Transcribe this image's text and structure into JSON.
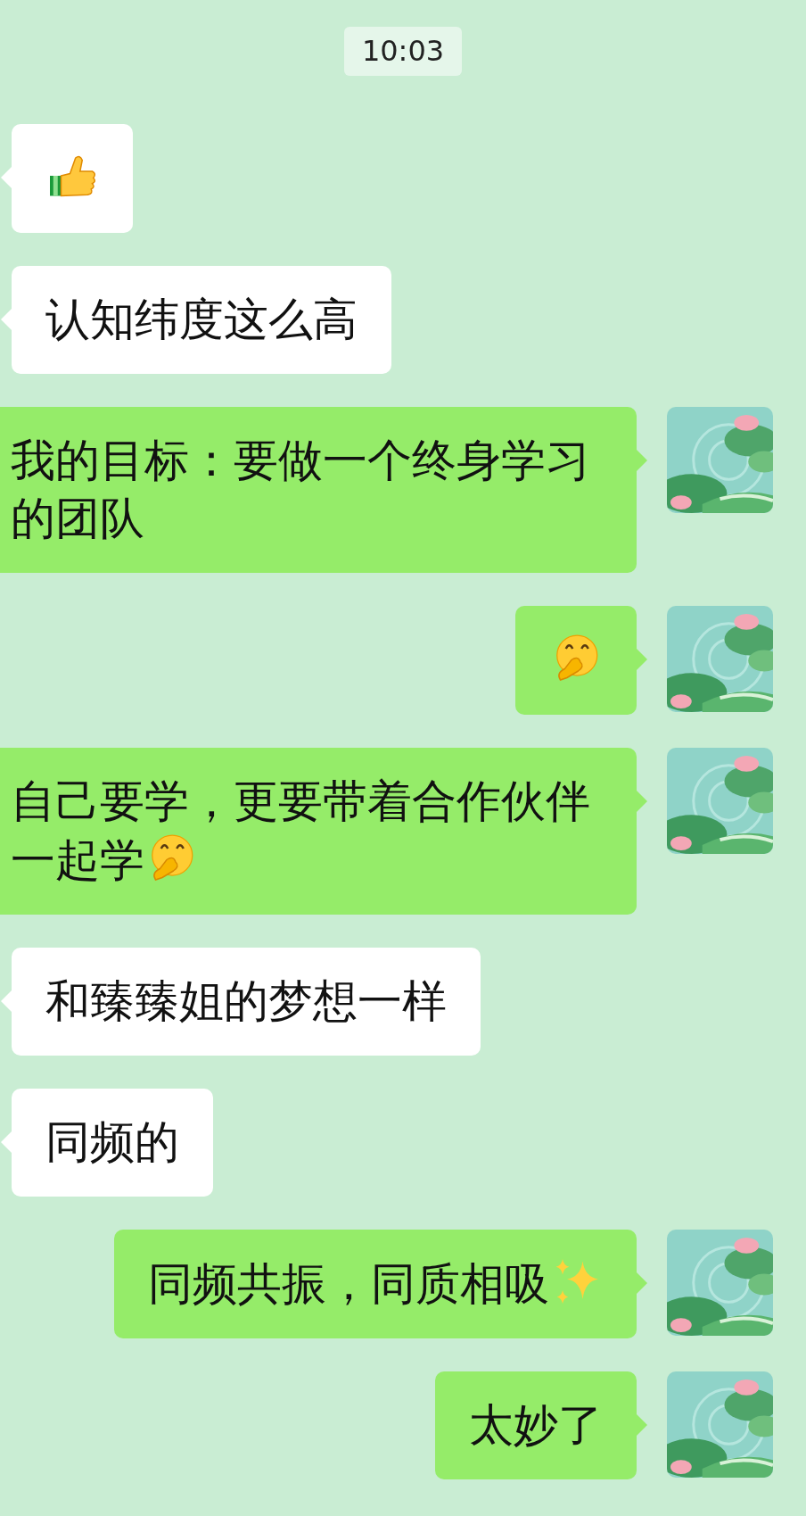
{
  "time": "10:03",
  "messages": [
    {
      "kind": "received",
      "parts": [
        {
          "kind": "thumbs"
        }
      ]
    },
    {
      "kind": "received",
      "parts": [
        {
          "kind": "text",
          "text": "认知纬度这么高"
        }
      ]
    },
    {
      "kind": "sent",
      "parts": [
        {
          "kind": "text",
          "text": "我的目标：要做一个终身学习的团队"
        }
      ]
    },
    {
      "kind": "sent",
      "parts": [
        {
          "kind": "giggle"
        }
      ]
    },
    {
      "kind": "sent",
      "parts": [
        {
          "kind": "text",
          "text": "自己要学，更要带着合作伙伴"
        },
        {
          "kind": "text",
          "text": "一起学"
        },
        {
          "kind": "giggle"
        }
      ]
    },
    {
      "kind": "received",
      "parts": [
        {
          "kind": "text",
          "text": "和臻臻姐的梦想一样"
        }
      ]
    },
    {
      "kind": "received",
      "parts": [
        {
          "kind": "text",
          "text": "同频的"
        }
      ]
    },
    {
      "kind": "sent",
      "parts": [
        {
          "kind": "text",
          "text": "同频共振，同质相吸"
        },
        {
          "kind": "sparkles"
        }
      ]
    },
    {
      "kind": "sent",
      "parts": [
        {
          "kind": "text",
          "text": "太妙了"
        }
      ]
    }
  ]
}
